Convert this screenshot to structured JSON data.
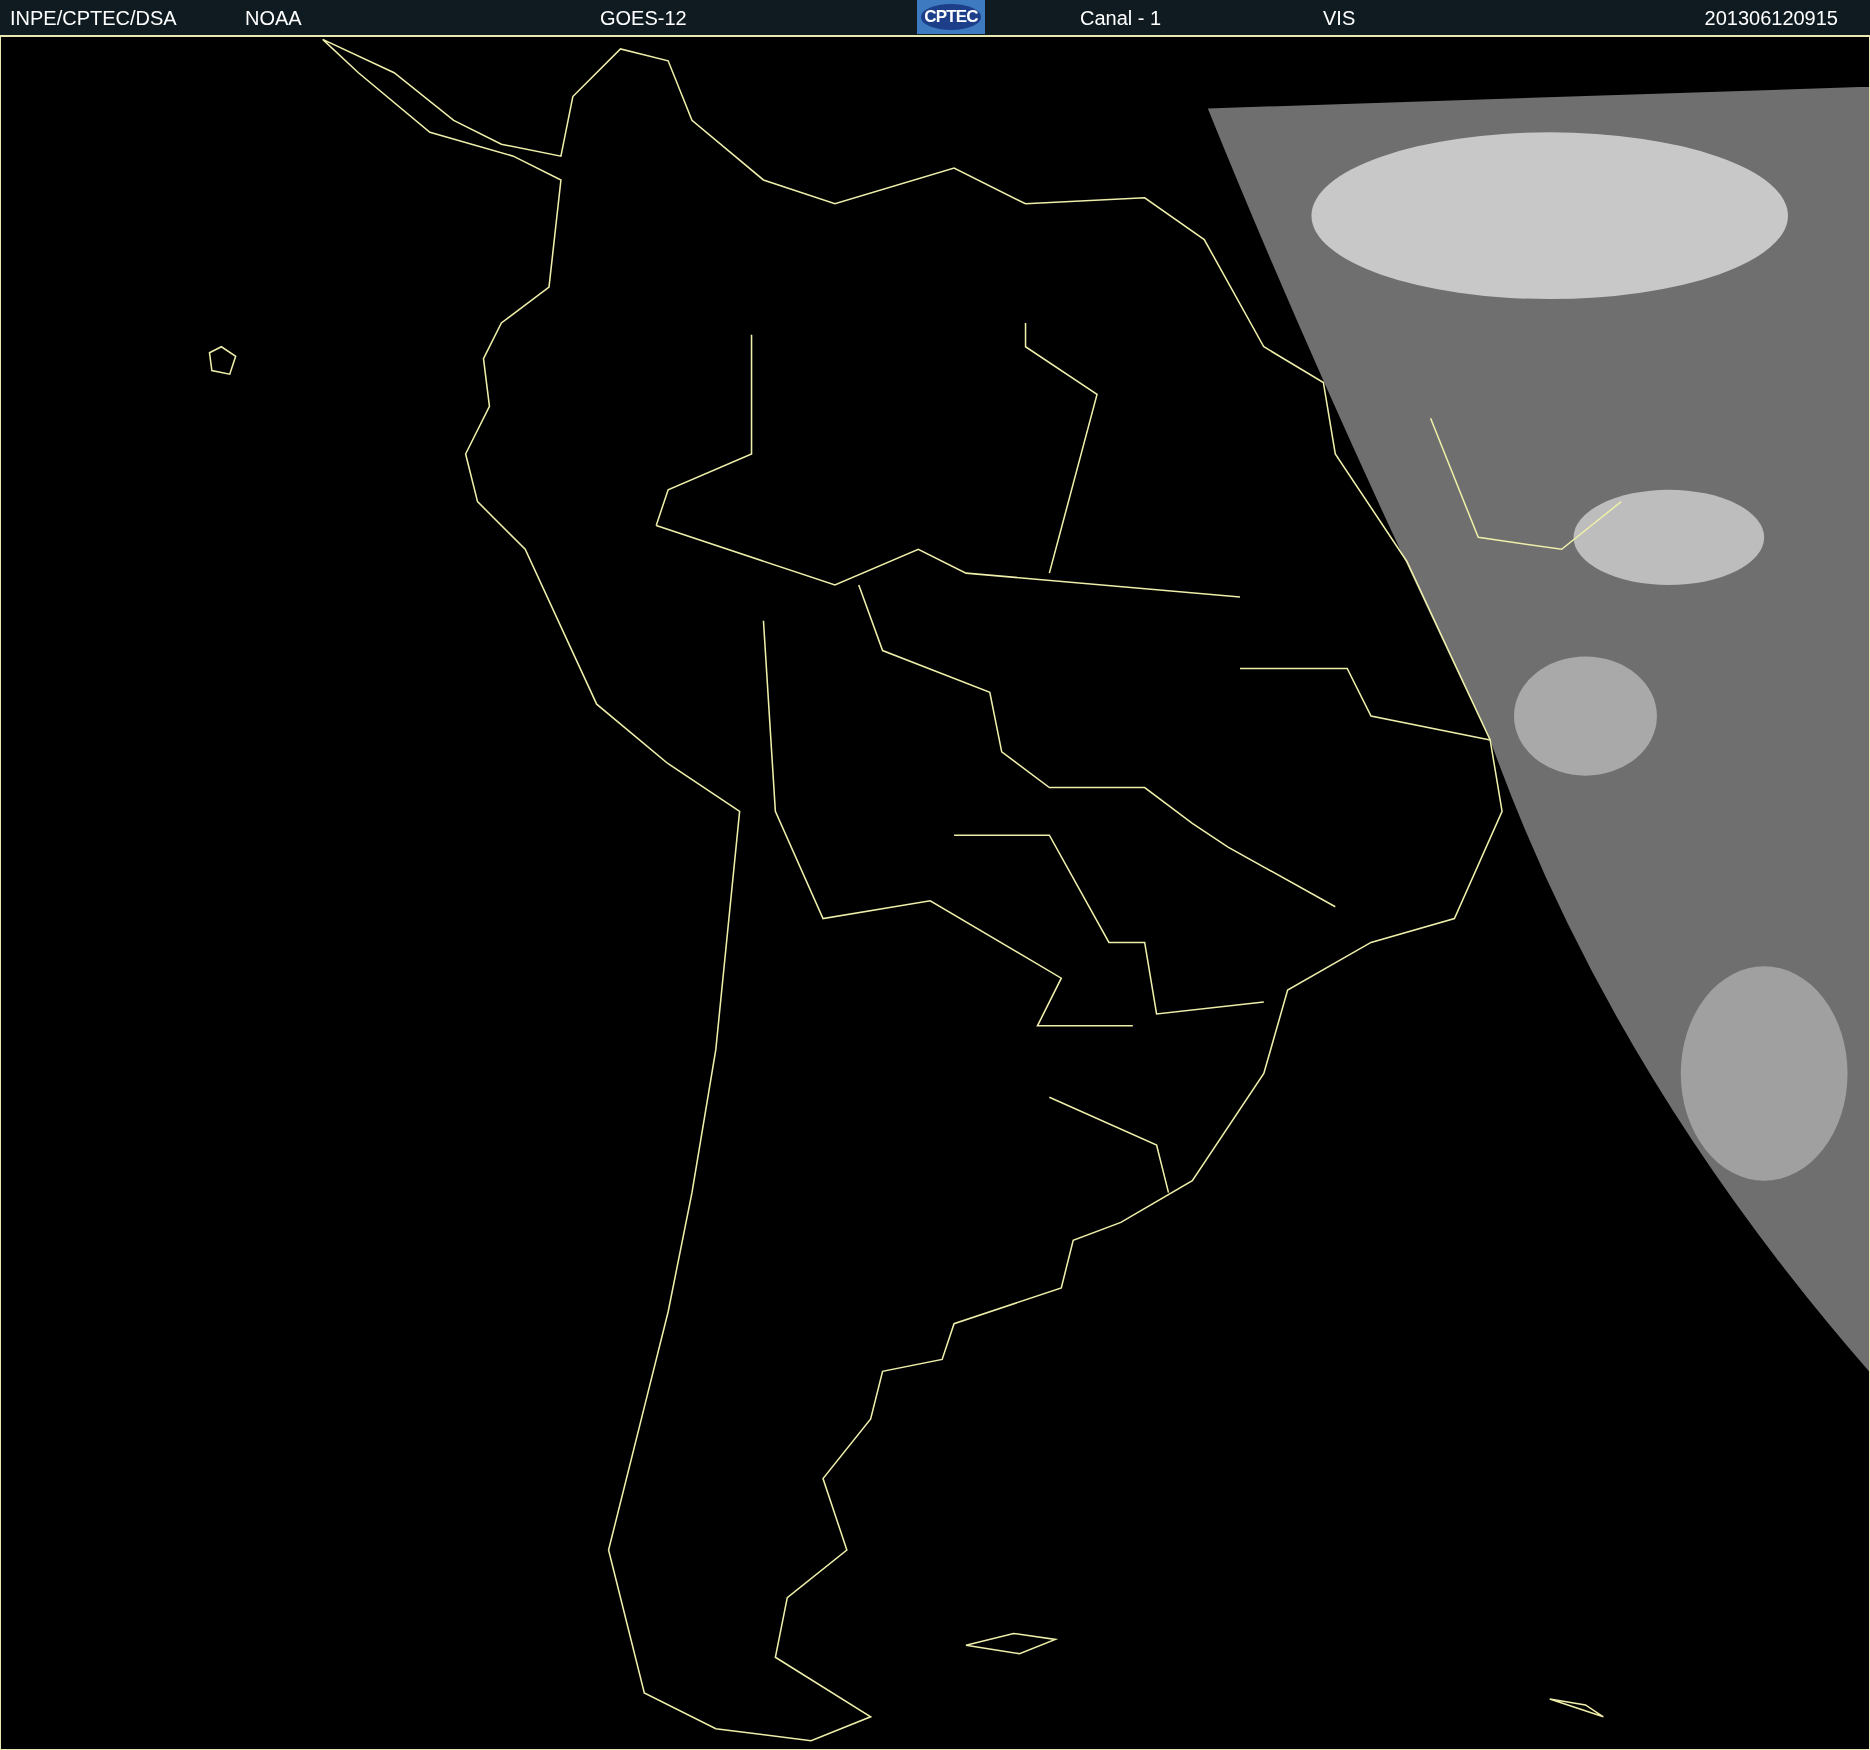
{
  "header": {
    "source": "INPE/CPTEC/DSA",
    "agency": "NOAA",
    "satellite": "GOES-12",
    "logo": "CPTEC",
    "channel": "Canal - 1",
    "band": "VIS",
    "timestamp": "201306120915"
  }
}
